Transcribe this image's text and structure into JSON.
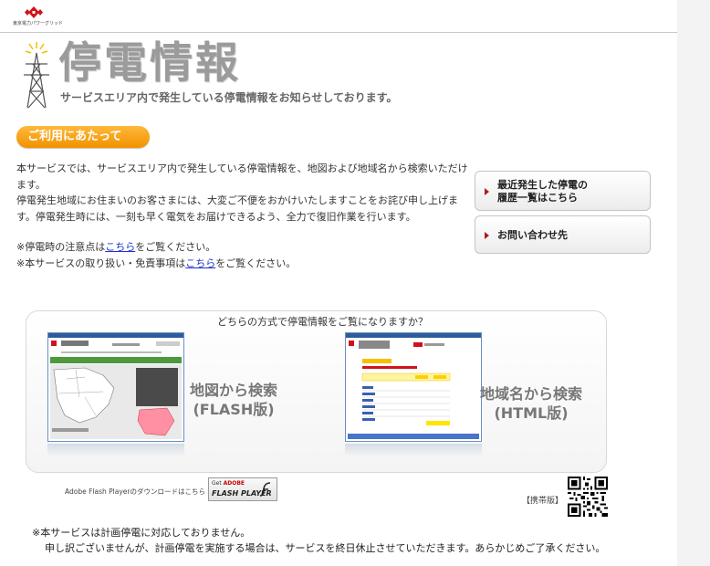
{
  "header": {
    "company": "東京電力パワーグリッド",
    "logo": "tepco-logo-icon"
  },
  "hero": {
    "title": "停電情報",
    "subtitle": "サービスエリア内で発生している停電情報をお知らせしております。",
    "icon": "power-tower-icon"
  },
  "usage_badge": "ご利用にあたって",
  "intro": "本サービスでは、サービスエリア内で発生している停電情報を、地図および地域名から検索いただけます。\n停電発生地域にお住まいのお客さまには、大変ご不便をおかけいたしますことをお詫び申し上げます。停電発生時には、一刻も早く電気をお届けできるよう、全力で復旧作業を行います。",
  "notes": {
    "note1_prefix": "※停電時の注意点は",
    "note1_link": "こちら",
    "note1_suffix": "をご覧ください。",
    "note2_prefix": "※本サービスの取り扱い・免責事項は",
    "note2_link": "こちら",
    "note2_suffix": "をご覧ください。"
  },
  "side_buttons": {
    "history": "最近発生した停電の\n履歴一覧はこちら",
    "contact": "お問い合わせ先"
  },
  "selector": {
    "question": "どちらの方式で停電情報をご覧になりますか？",
    "map_option": "地図から検索\n(FLASH版)",
    "area_option": "地域名から検索\n(HTML版)"
  },
  "flash": {
    "download_text": "Adobe Flash Playerのダウンロードはこちら",
    "badge_get": "Get",
    "badge_adobe": "ADOBE",
    "badge_player": "FLASH PLAYER"
  },
  "mobile_label": "【携帯版】",
  "notice": {
    "line1": "※本サービスは計画停電に対応しておりません。",
    "line2": "申し訳ございませんが、計画停電を実施する場合は、サービスを終日休止させていただきます。あらかじめご了承ください。"
  },
  "colors": {
    "accent_orange": "#f29200",
    "link_blue": "#1a33cc",
    "brand_red": "#d0121b"
  }
}
